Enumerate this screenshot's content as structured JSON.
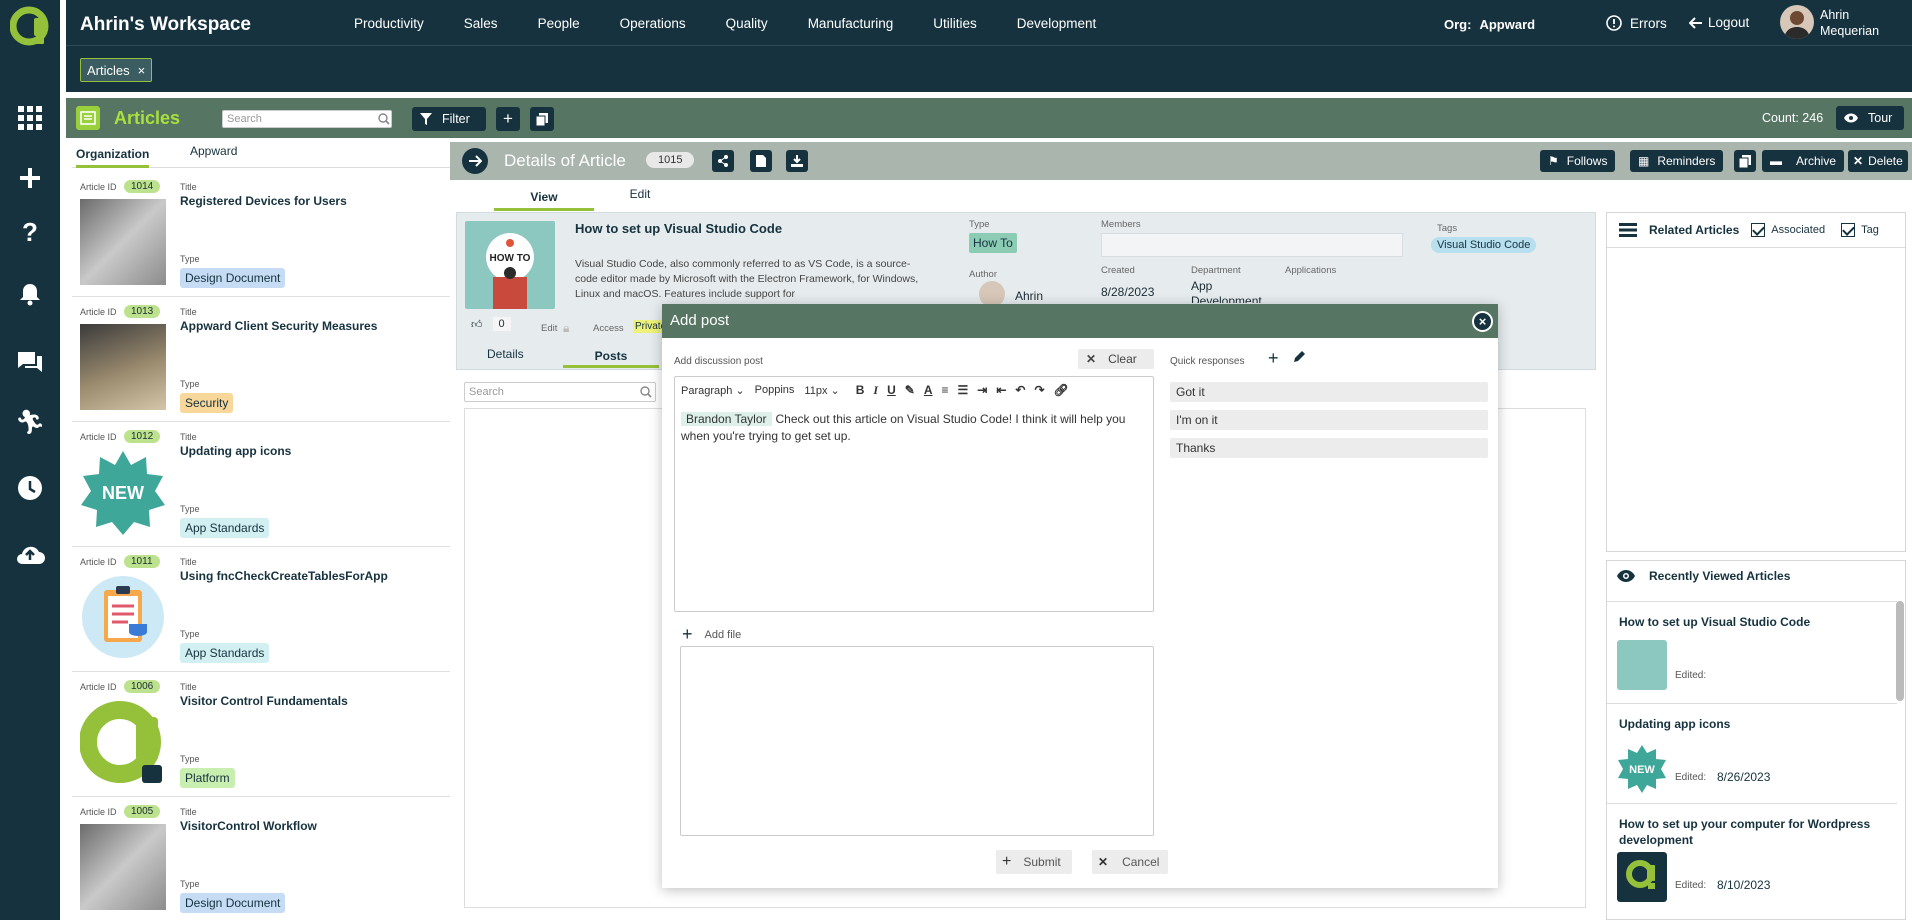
{
  "app": {
    "workspace_title": "Ahrin's Workspace",
    "nav": [
      "Productivity",
      "Sales",
      "People",
      "Operations",
      "Quality",
      "Manufacturing",
      "Utilities",
      "Development"
    ],
    "org_label": "Org:",
    "org_value": "Appward",
    "errors_label": "Errors",
    "logout_label": "Logout",
    "user_name_line1": "Ahrin",
    "user_name_line2": "Mequerian"
  },
  "tabstrip": {
    "tab_label": "Articles",
    "close": "×"
  },
  "module": {
    "title": "Articles",
    "search_placeholder": "Search",
    "filter_label": "Filter",
    "count_label": "Count: 246",
    "tour_label": "Tour"
  },
  "list": {
    "tabs": [
      "Organization",
      "Appward"
    ],
    "id_label": "Article ID",
    "title_label": "Title",
    "type_label": "Type",
    "items": [
      {
        "id": "1014",
        "title": "Registered Devices for Users",
        "type": "Design Document",
        "type_color": "#c6dcf4"
      },
      {
        "id": "1013",
        "title": "Appward Client Security Measures",
        "type": "Security",
        "type_color": "#f8d79a"
      },
      {
        "id": "1012",
        "title": "Updating app icons",
        "type": "App Standards",
        "type_color": "#d2f0f2"
      },
      {
        "id": "1011",
        "title": "Using fncCheckCreateTablesForApp",
        "type": "App Standards",
        "type_color": "#d2f0f2"
      },
      {
        "id": "1006",
        "title": "Visitor Control Fundamentals",
        "type": "Platform",
        "type_color": "#c8eeb0"
      },
      {
        "id": "1005",
        "title": "VisitorControl Workflow",
        "type": "Design Document",
        "type_color": "#c6dcf4"
      }
    ]
  },
  "details": {
    "header": "Details of Article",
    "id": "1015",
    "buttons": {
      "follows": "Follows",
      "reminders": "Reminders",
      "archive": "Archive",
      "delete": "Delete"
    },
    "tabs": {
      "view": "View",
      "edit": "Edit"
    },
    "title": "How to set up Visual Studio Code",
    "description": "Visual Studio Code, also commonly referred to as VS Code, is a source-code editor made by Microsoft with the Electron Framework, for Windows, Linux and macOS. Features include support for",
    "image_text": "HOW TO",
    "labels": {
      "type": "Type",
      "members": "Members",
      "tags": "Tags",
      "author": "Author",
      "created": "Created",
      "department": "Department",
      "applications": "Applications",
      "edit": "Edit",
      "access": "Access"
    },
    "type": "How To",
    "tag": "Visual Studio Code",
    "author": "Ahrin",
    "created": "8/28/2023",
    "department": "App Development",
    "like_count": "0",
    "access": "Private",
    "subtabs": {
      "details": "Details",
      "posts": "Posts"
    },
    "posts_search_placeholder": "Search"
  },
  "related": {
    "title": "Related Articles",
    "associated": "Associated",
    "tag": "Tag"
  },
  "recent": {
    "title": "Recently Viewed Articles",
    "edited_label": "Edited:",
    "items": [
      {
        "title": "How to set up Visual Studio Code",
        "date": ""
      },
      {
        "title": "Updating app icons",
        "date": "8/26/2023"
      },
      {
        "title": "How to set up your computer for Wordpress development",
        "date": "8/10/2023"
      }
    ]
  },
  "modal": {
    "title": "Add post",
    "close": "×",
    "field_label": "Add discussion post",
    "clear_label": "Clear",
    "toolbar": {
      "paragraph": "Paragraph",
      "font": "Poppins",
      "size": "11px"
    },
    "mention": "Brandon Taylor",
    "body": "Check out this article on Visual Studio Code! I think it will help you when you're trying to get set up.",
    "add_file": "Add file",
    "submit": "Submit",
    "cancel": "Cancel",
    "quick_label": "Quick responses",
    "quick": [
      "Got it",
      "I'm on it",
      "Thanks"
    ]
  },
  "colors": {
    "rail": "#16323e",
    "accent": "#94c03a",
    "module": "#567562"
  }
}
